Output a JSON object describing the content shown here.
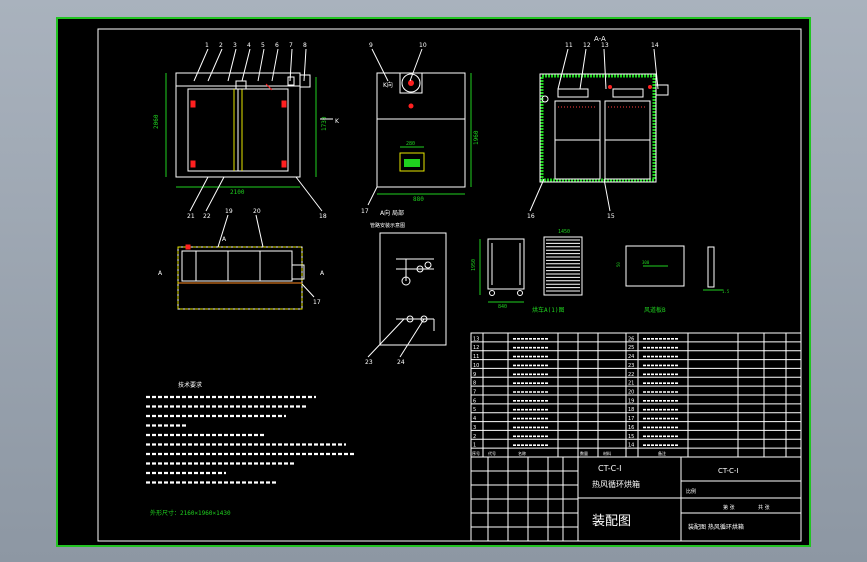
{
  "section_label": "A-A",
  "view_label_k": "K向",
  "local_view_label": "A向 局部",
  "pipe_diagram_title": "管路安装示意图",
  "notes_title": "技术要求",
  "outer_size_text": "外形尺寸：2160×1960×1430",
  "part_view_a_label": "烘车A(1)图",
  "part_view_b_label": "风道板B",
  "dims": {
    "front_height": "2060",
    "front_width": "2100",
    "side_height": "1960",
    "side_width": "880",
    "panel_w": "280",
    "cart_h": "1950",
    "cart_w": "840",
    "cart_depth": "1450",
    "board_w": "300",
    "board_h": "50",
    "board_t": "1.5"
  },
  "balloons": {
    "front_top": [
      "1",
      "2",
      "3",
      "4",
      "5",
      "6",
      "7",
      "8"
    ],
    "side_top": [
      "9",
      "10"
    ],
    "section_top": [
      "11",
      "12",
      "13",
      "14"
    ],
    "front_bottom": [
      "21",
      "22",
      "18"
    ],
    "side_bottom": [
      "17"
    ],
    "section_bottom": [
      "16",
      "15"
    ],
    "plan_top": [
      "19",
      "20"
    ],
    "plan_side": [
      "17"
    ],
    "pipe_bottom": [
      "23",
      "24"
    ]
  },
  "title_block": {
    "drawing_no": "CT-C-I",
    "product_name": "热风循环烘箱",
    "drawing_title": "装配图",
    "company_text": "装配图 热风循环烘箱",
    "code_right": "CT-C-I",
    "scale_label": "比例",
    "sheet_label": "第 张",
    "count_label": "共 张"
  },
  "bom_left_numbers": [
    "13",
    "12",
    "11",
    "10",
    "9",
    "8",
    "7",
    "6",
    "5",
    "4",
    "3",
    "2",
    "1"
  ],
  "bom_right_numbers": [
    "26",
    "25",
    "24",
    "23",
    "22",
    "21",
    "20",
    "19",
    "18",
    "17",
    "16",
    "15",
    "14"
  ],
  "bom_header": [
    "序号",
    "代号",
    "名称",
    "数量",
    "材料",
    "备注"
  ]
}
